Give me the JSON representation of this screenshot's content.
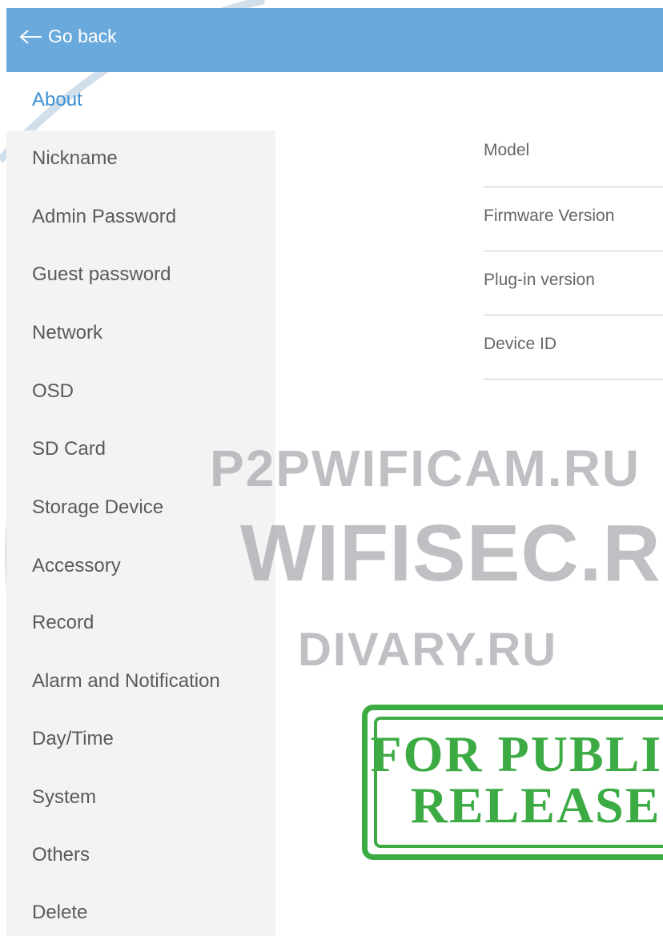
{
  "header": {
    "back_label": "Go back"
  },
  "sidebar": {
    "active_label": "About",
    "items": [
      "Nickname",
      "Admin Password",
      "Guest password",
      "Network",
      "OSD",
      "SD Card",
      "Storage Device",
      "Accessory",
      "Record",
      "Alarm and Notification",
      "Day/Time",
      "System",
      "Others",
      "Delete"
    ]
  },
  "about_info": {
    "rows": [
      "Model",
      "Firmware Version",
      "Plug-in version",
      "Device ID"
    ]
  },
  "watermark": {
    "line1": "P2PWIFICAM.RU",
    "line2": "WIFISEC.RU",
    "line3": "DIVARY.RU",
    "stamp_line1": "FOR PUBLIC",
    "stamp_line2": "RELEASE"
  },
  "colors": {
    "header_bg": "#69a9dc",
    "active_text": "#3d8fd5",
    "sidebar_bg": "#f3f3f3",
    "stamp": "#3cab44"
  }
}
